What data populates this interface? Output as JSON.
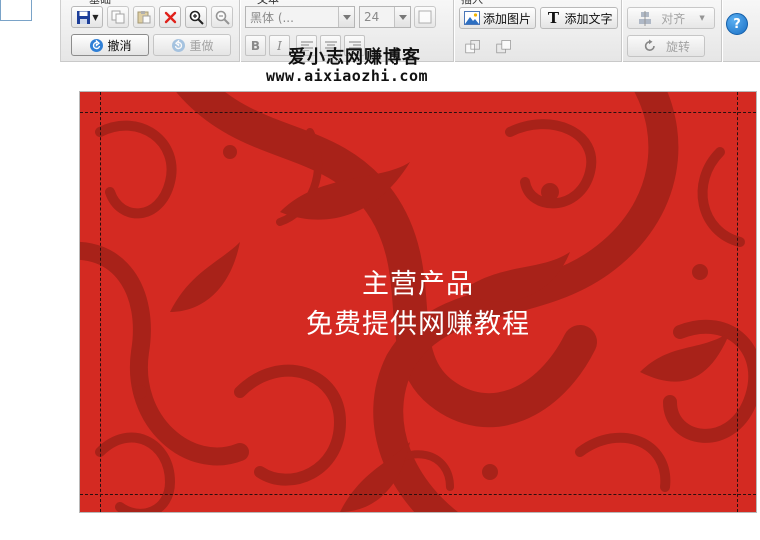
{
  "toolbar": {
    "groups": {
      "edit": "基础",
      "text": "文本",
      "insert": "插入"
    },
    "undo_label": "撤消",
    "redo_label": "重做",
    "font_family": "黑体 (...",
    "font_size": "24",
    "add_image_label": "添加图片",
    "add_text_label": "添加文字",
    "align_label": "对齐",
    "rotate_label": "旋转",
    "bold_label": "B",
    "italic_label": "I",
    "help_label": "?"
  },
  "watermark": {
    "title": "爱小志网赚博客",
    "url": "www.aixiaozhi.com"
  },
  "card": {
    "line1": "主营产品",
    "line2": "免费提供网赚教程",
    "background_color": "#d42a22",
    "pattern_color": "#a82219"
  }
}
